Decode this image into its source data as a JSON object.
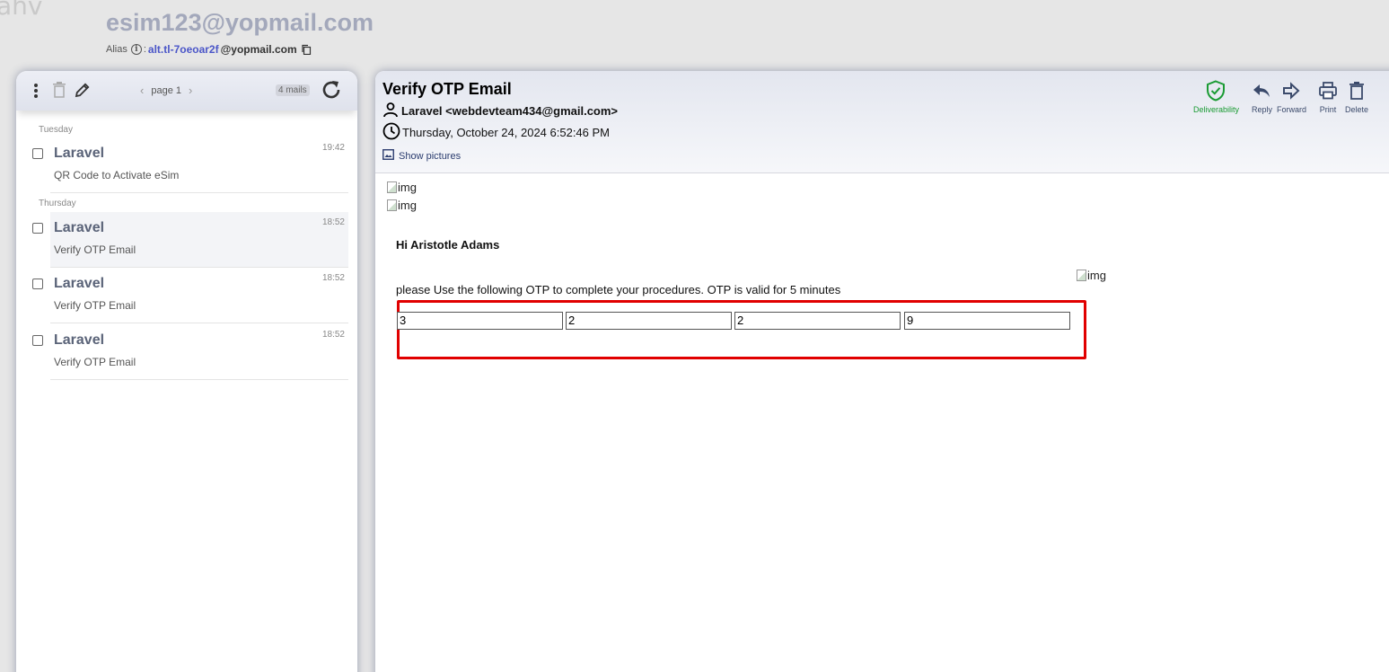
{
  "header": {
    "logo_text": "ahv",
    "inbox_address": "esim123@yopmail.com",
    "alias_label": "Alias",
    "alias_separator": ":",
    "alias_user": "alt.tl-7oeoar2f",
    "alias_domain": "@yopmail.com"
  },
  "mail_list": {
    "pager_label": "page 1",
    "count_badge": "4 mails",
    "groups": [
      {
        "day": "Tuesday"
      },
      {
        "day": "Thursday"
      }
    ],
    "items": [
      {
        "from": "Laravel",
        "subject": "QR Code to Activate eSim",
        "time": "19:42"
      },
      {
        "from": "Laravel",
        "subject": "Verify OTP Email",
        "time": "18:52"
      },
      {
        "from": "Laravel",
        "subject": "Verify OTP Email",
        "time": "18:52"
      },
      {
        "from": "Laravel",
        "subject": "Verify OTP Email",
        "time": "18:52"
      }
    ]
  },
  "message": {
    "subject": "Verify OTP Email",
    "from": "Laravel <webdevteam434@gmail.com>",
    "date": "Thursday, October 24, 2024 6:52:46 PM",
    "show_pictures": "Show pictures",
    "actions": {
      "deliverability": "Deliverability",
      "reply": "Reply",
      "forward": "Forward",
      "print": "Print",
      "delete": "Delete"
    },
    "img_alt": "img",
    "greeting": "Hi Aristotle Adams",
    "body_text": "please Use the following OTP to complete your procedures. OTP is valid for 5 minutes",
    "otp_digits": [
      "3",
      "2",
      "2",
      "9"
    ]
  },
  "colors": {
    "accent_blue": "#4b56c8",
    "deliverability_green": "#1a9b33",
    "highlight_red": "#e10000"
  }
}
